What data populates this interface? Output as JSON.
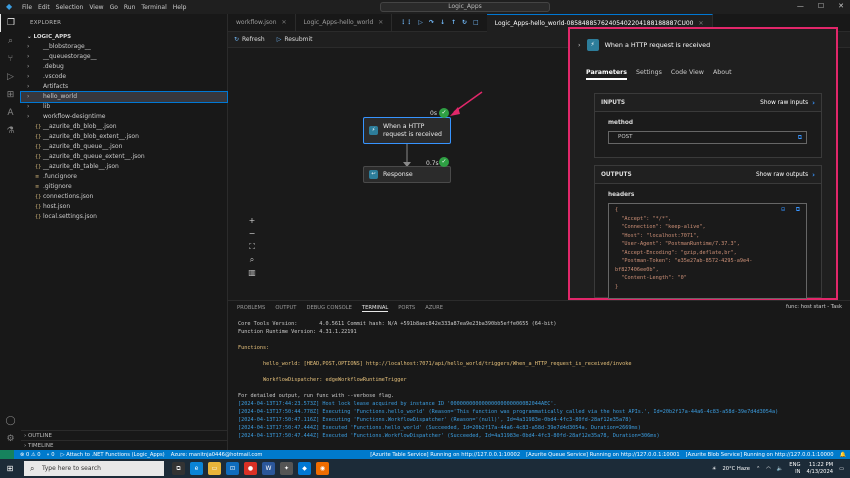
{
  "menu": [
    "File",
    "Edit",
    "Selection",
    "View",
    "Go",
    "Run",
    "Terminal",
    "Help"
  ],
  "window_title": "Logic_Apps",
  "sidebar": {
    "header": "EXPLORER",
    "project": "LOGIC_APPS",
    "items": [
      {
        "chev": "›",
        "icon": "folder",
        "label": "__blobstorage__"
      },
      {
        "chev": "›",
        "icon": "folder",
        "label": "__queuestorage__"
      },
      {
        "chev": "›",
        "icon": "folder",
        "label": ".debug"
      },
      {
        "chev": "›",
        "icon": "folder",
        "label": ".vscode"
      },
      {
        "chev": "›",
        "icon": "folder",
        "label": "Artifacts"
      },
      {
        "chev": "›",
        "icon": "folder",
        "label": "hello_world",
        "selected": true
      },
      {
        "chev": "›",
        "icon": "folder",
        "label": "lib"
      },
      {
        "chev": "›",
        "icon": "folder",
        "label": "workflow-designtime"
      },
      {
        "chev": "",
        "icon": "json",
        "label": "__azurite_db_blob__.json"
      },
      {
        "chev": "",
        "icon": "json",
        "label": "__azurite_db_blob_extent__.json"
      },
      {
        "chev": "",
        "icon": "json",
        "label": "__azurite_db_queue__.json"
      },
      {
        "chev": "",
        "icon": "json",
        "label": "__azurite_db_queue_extent__.json"
      },
      {
        "chev": "",
        "icon": "json",
        "label": "__azurite_db_table__.json"
      },
      {
        "chev": "",
        "icon": "file",
        "label": ".funcignore"
      },
      {
        "chev": "",
        "icon": "file",
        "label": ".gitignore"
      },
      {
        "chev": "",
        "icon": "json",
        "label": "connections.json"
      },
      {
        "chev": "",
        "icon": "json",
        "label": "host.json"
      },
      {
        "chev": "",
        "icon": "json",
        "label": "local.settings.json"
      }
    ],
    "outline": "OUTLINE",
    "timeline": "TIMELINE"
  },
  "tabs": [
    {
      "label": "workflow.json",
      "active": false
    },
    {
      "label": "Logic_Apps-hello_world",
      "active": false
    },
    {
      "label": "Logic_Apps-hello_world-08584885762405402204188188887CU00",
      "active": true
    }
  ],
  "toolbar": {
    "refresh": "Refresh",
    "resubmit": "Resubmit"
  },
  "designer": {
    "trigger": {
      "label": "When a HTTP request is received",
      "duration": "0s"
    },
    "action": {
      "label": "Response",
      "duration": "0.7s"
    }
  },
  "details": {
    "title": "When a HTTP request is received",
    "tabs": [
      "Parameters",
      "Settings",
      "Code View",
      "About"
    ],
    "inputs": {
      "title": "INPUTS",
      "button": "Show raw inputs",
      "field": "method",
      "value": "POST"
    },
    "outputs": {
      "title": "OUTPUTS",
      "button": "Show raw outputs",
      "field": "headers",
      "lines": [
        "{",
        "  \"Accept\": \"*/*\",",
        "  \"Connection\": \"keep-alive\",",
        "  \"Host\": \"localhost:7071\",",
        "  \"User-Agent\": \"PostmanRuntime/7.37.3\",",
        "  \"Accept-Encoding\": \"gzip,deflate,br\",",
        "  \"Postman-Token\": \"e35e27ab-8572-4295-a9e4-",
        "bf827406ee0b\",",
        "  \"Content-Length\": \"0\"",
        "}"
      ]
    }
  },
  "panel": {
    "tabs": [
      "PROBLEMS",
      "OUTPUT",
      "DEBUG CONSOLE",
      "TERMINAL",
      "PORTS",
      "AZURE"
    ],
    "active": "TERMINAL",
    "task": "func: host start - Task",
    "terminal": [
      {
        "cls": "",
        "text": "Core Tools Version:       4.0.5611 Commit hash: N/A +591b8aec842e333a87ea9e23ba390bb5effe0655 (64-bit)"
      },
      {
        "cls": "",
        "text": "Function Runtime Version: 4.31.1.22191"
      },
      {
        "cls": "",
        "text": ""
      },
      {
        "cls": "yel",
        "text": "Functions:"
      },
      {
        "cls": "",
        "text": ""
      },
      {
        "cls": "yel",
        "text": "        hello_world: [HEAD,POST,OPTIONS] http://localhost:7071/api/hello_world/triggers/When_a_HTTP_request_is_received/invoke"
      },
      {
        "cls": "",
        "text": ""
      },
      {
        "cls": "yel",
        "text": "        WorkflowDispatcher: edgeWorkflowRuntimeTrigger"
      },
      {
        "cls": "",
        "text": ""
      },
      {
        "cls": "",
        "text": "For detailed output, run func with --verbose flag."
      },
      {
        "cls": "blu",
        "text": "[2024-04-13T17:44:23.573Z] Host lock lease acquired by instance ID '000000000000000000000000B2044AEC'."
      },
      {
        "cls": "blu",
        "text": "[2024-04-13T17:50:44.778Z] Executing 'Functions.hello_world' (Reason='This function was programmatically called via the host APIs.', Id=20b2f17a-44a6-4c83-a58d-39e7d4d3054a)"
      },
      {
        "cls": "blu",
        "text": "[2024-04-13T17:50:47.116Z] Executing 'Functions.WorkflowDispatcher' (Reason='(null)', Id=4a31983e-0bd4-4fc3-80fd-28af12e35a78)"
      },
      {
        "cls": "blu",
        "text": "[2024-04-13T17:50:47.444Z] Executed 'Functions.hello_world' (Succeeded, Id=20b2f17a-44a6-4c83-a58d-39e7d4d3054a, Duration=2669ms)"
      },
      {
        "cls": "blu",
        "text": "[2024-04-13T17:50:47.444Z] Executed 'Functions.WorkflowDispatcher' (Succeeded, Id=4a31983e-0bd4-4fc3-80fd-28af12e35a78, Duration=306ms)"
      }
    ]
  },
  "statusbar": {
    "left": [
      "⊗ 0 ⚠ 0",
      "⑂ 0",
      "▷ Attach to .NET Functions (Logic_Apps)",
      "Azure: manitnja0446@hotmail.com"
    ],
    "right": [
      "[Azurite Table Service] Running on http://127.0.0.1:10002",
      "[Azurite Queue Service] Running on http://127.0.0.1:10001",
      "[Azurite Blob Service] Running on http://127.0.0.1:10000",
      "🔔"
    ]
  },
  "taskbar": {
    "search_placeholder": "Type here to search",
    "weather": "20°C Haze",
    "lang": "ENG",
    "region": "IN",
    "time": "11:22 PM",
    "date": "4/13/2024"
  }
}
